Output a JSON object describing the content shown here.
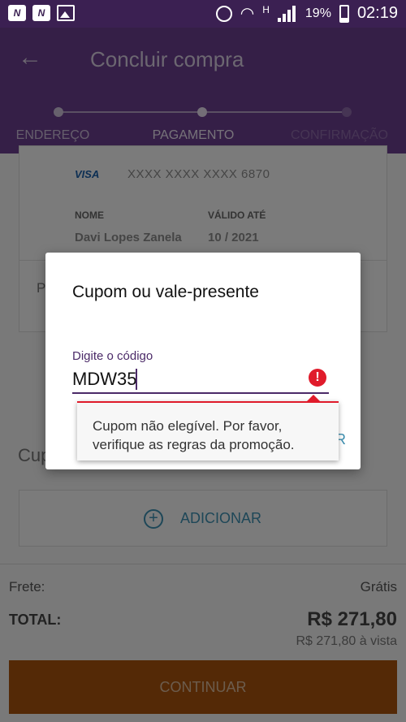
{
  "status_bar": {
    "battery": "19%",
    "time": "02:19",
    "network_type": "H",
    "left_icons": [
      "N",
      "N"
    ]
  },
  "app_bar": {
    "title": "Concluir compra"
  },
  "stepper": {
    "steps": [
      "ENDEREÇO",
      "PAGAMENTO",
      "CONFIRMAÇÃO"
    ],
    "active_index": 1
  },
  "payment_card": {
    "brand": "VISA",
    "number": "XXXX XXXX XXXX 6870",
    "name_label": "NOME",
    "name_value": "Davi Lopes Zanela",
    "valid_label": "VÁLIDO ATÉ",
    "valid_value": "10 / 2021",
    "field_partial": "P"
  },
  "coupon_section": {
    "title_partial": "Cup",
    "add_label": "ADICIONAR"
  },
  "footer": {
    "frete_label": "Frete:",
    "frete_value": "Grátis",
    "total_label": "TOTAL:",
    "total_value": "R$ 271,80",
    "installment": "R$ 271,80 à vista",
    "continue_label": "CONTINUAR"
  },
  "dialog": {
    "title": "Cupom ou vale-presente",
    "input_label": "Digite o código",
    "input_value": "MDW35",
    "error_message": "Cupom não elegível. Por favor, verifique as regras da promoção.",
    "action_partial": "R"
  },
  "colors": {
    "primary": "#6a3f8e",
    "status_bar": "#3b2052",
    "accent": "#3d8fb0",
    "error": "#e01b2b",
    "button": "#a8530c"
  }
}
